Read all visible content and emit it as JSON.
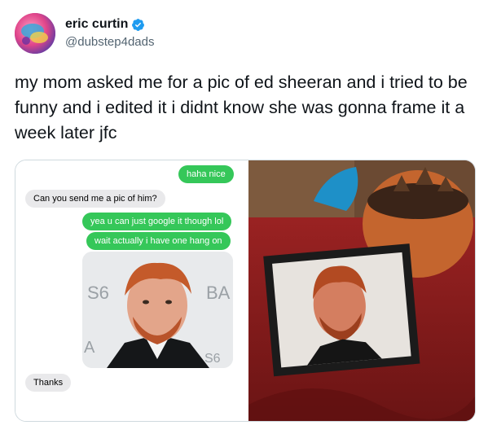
{
  "author": {
    "name": "eric curtin",
    "handle": "@dubstep4dads",
    "verified": true,
    "verified_color": "#1d9bf0"
  },
  "tweet": {
    "text": "my mom asked me for a pic of ed sheeran and i tried to be funny and i edited it i didnt know she was gonna frame it a week later jfc"
  },
  "messages": [
    {
      "from": "me",
      "text": "haha nice"
    },
    {
      "from": "them",
      "text": "Can you send me a pic of him?"
    },
    {
      "from": "me",
      "text": "yea u can just google it though lol"
    },
    {
      "from": "me",
      "text": "wait actually i have one hang on"
    },
    {
      "from": "me",
      "type": "photo"
    },
    {
      "from": "them",
      "text": "Thanks"
    }
  ],
  "photo_backdrop_text": {
    "left": "S6",
    "right": "BA",
    "bottom_left": "A",
    "bottom_right": "S6"
  },
  "colors": {
    "outgoing_bubble": "#35c759",
    "incoming_bubble": "#e9e9eb",
    "tablecloth": "#8b1c1c"
  }
}
